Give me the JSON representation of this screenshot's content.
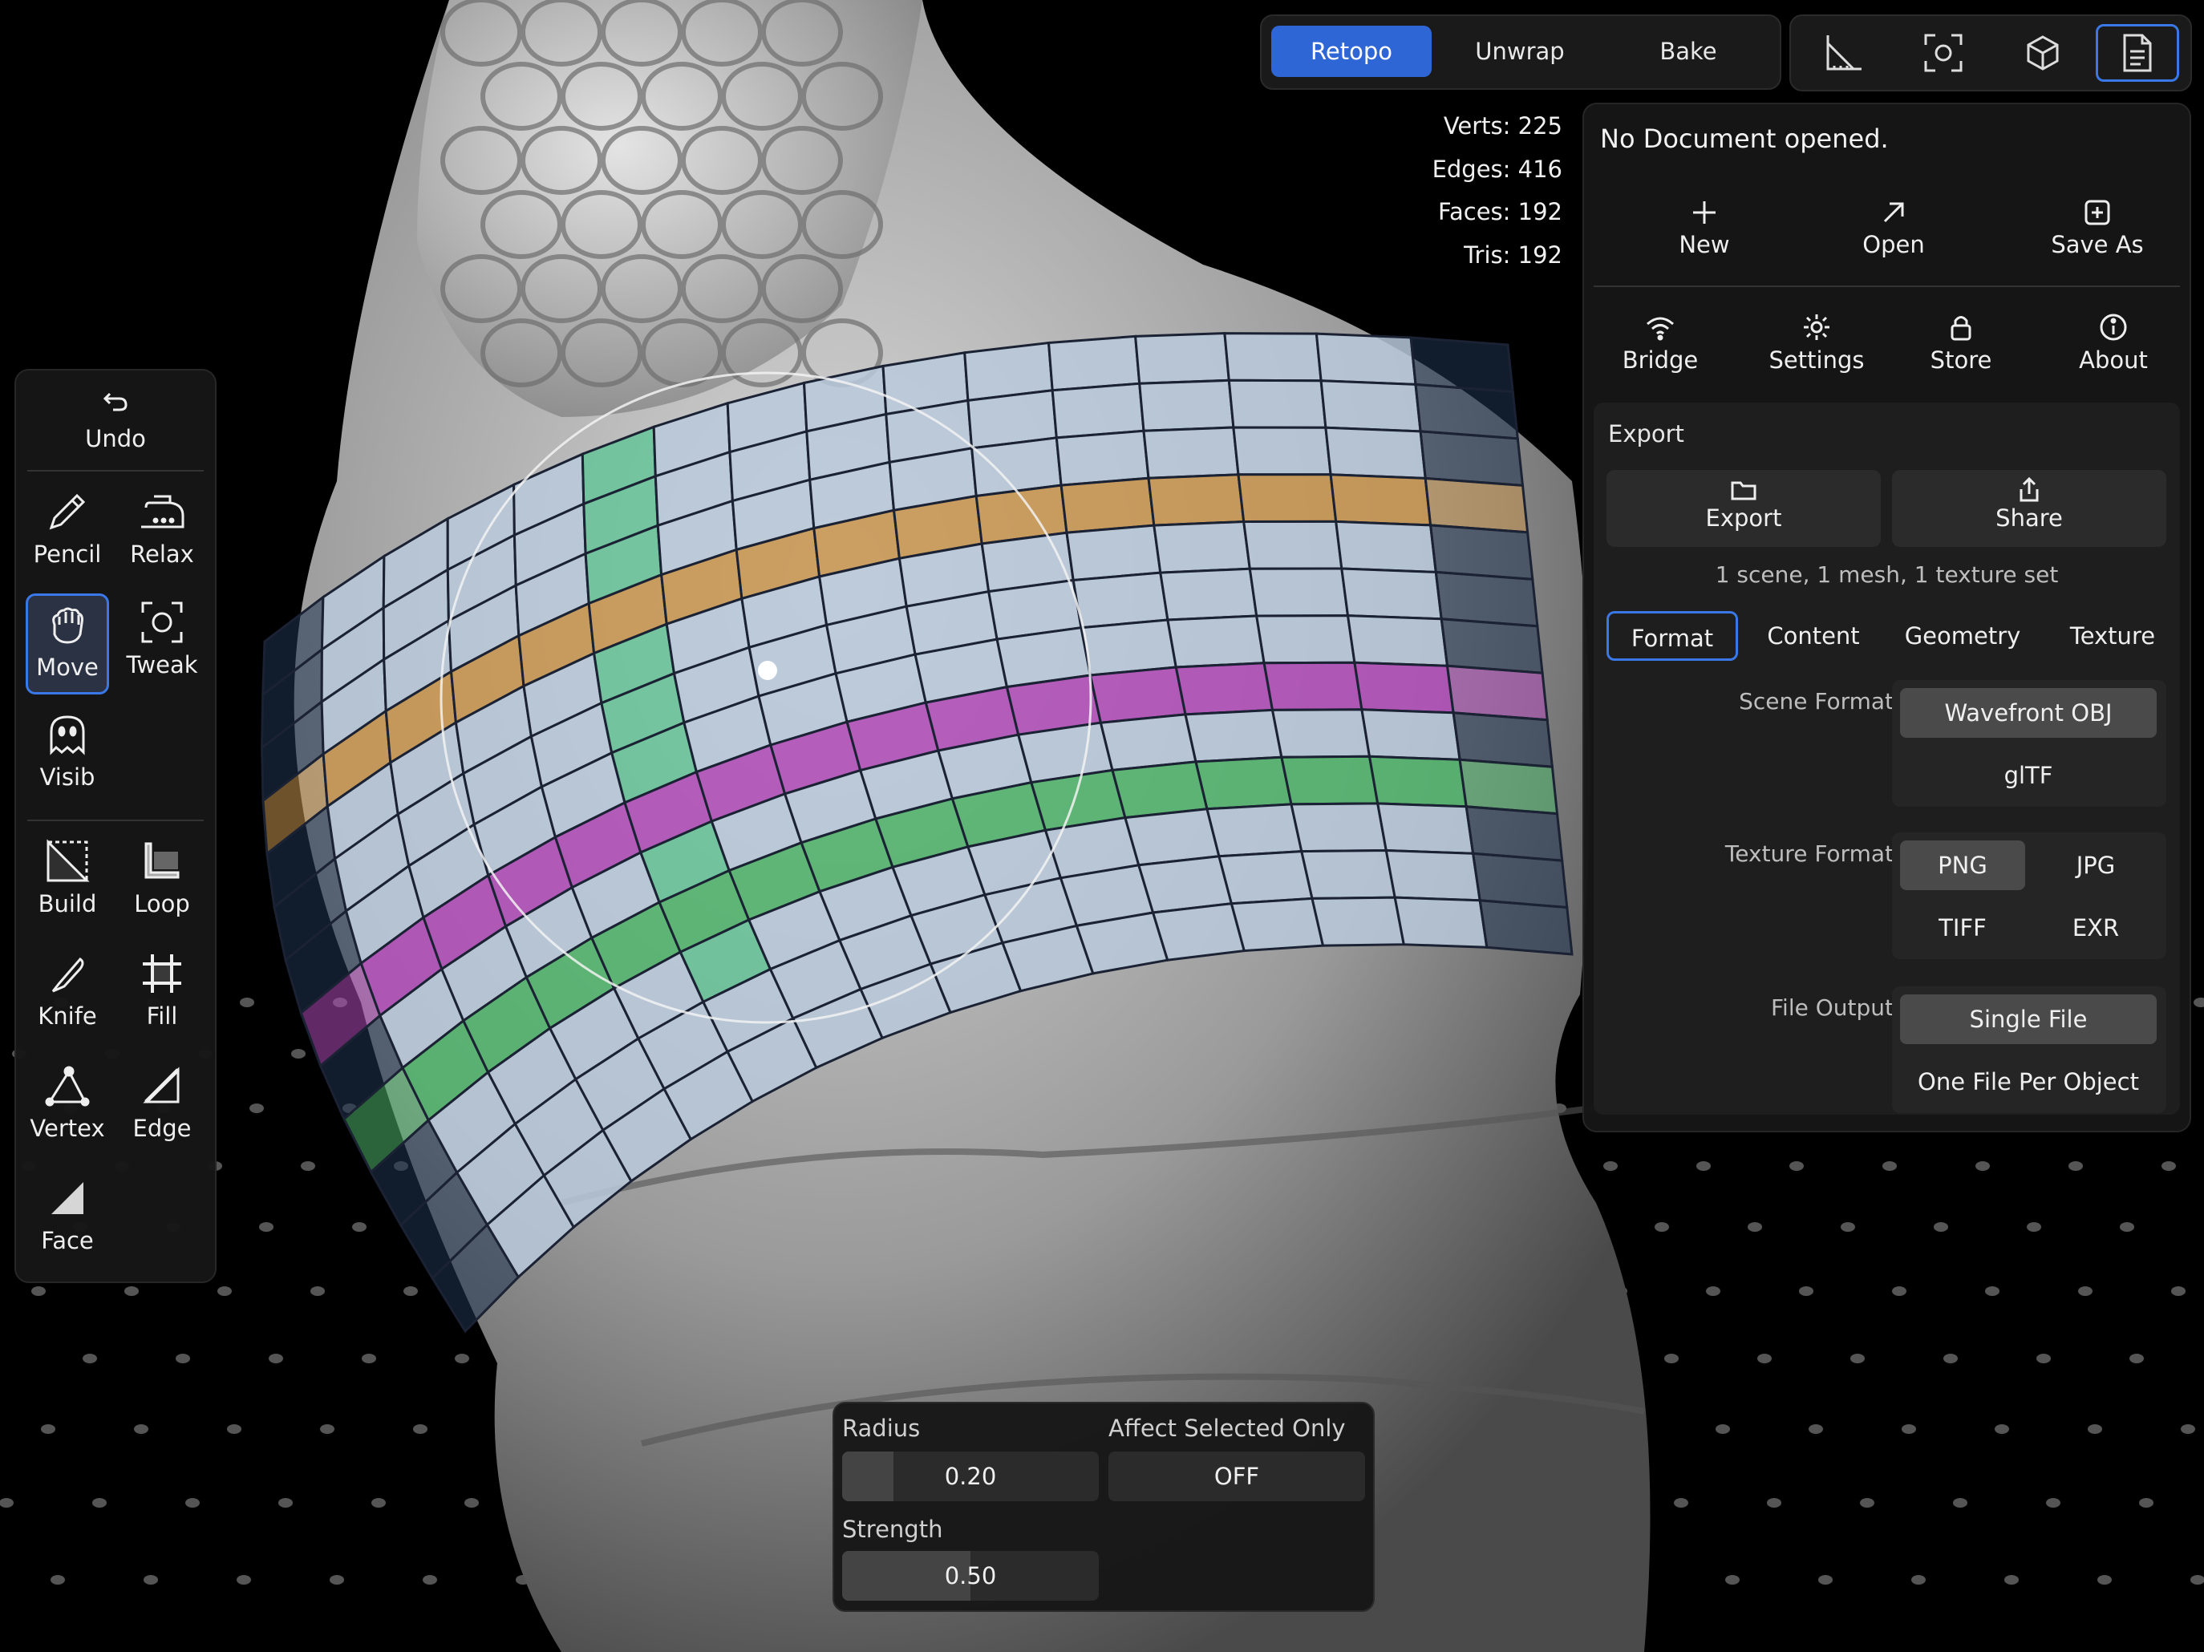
{
  "mode_tabs": {
    "retopo": "Retopo",
    "unwrap": "Unwrap",
    "bake": "Bake",
    "active": "Retopo"
  },
  "view_tools": {
    "icons": [
      "ruler-triangle-icon",
      "focus-frame-icon",
      "cube-icon",
      "document-icon"
    ],
    "active": "document-icon"
  },
  "stats": {
    "verts": "Verts: 225",
    "edges": "Edges: 416",
    "faces": "Faces: 192",
    "tris": "Tris: 192"
  },
  "doc": {
    "title": "No Document opened.",
    "new": "New",
    "open": "Open",
    "save_as": "Save As",
    "bridge": "Bridge",
    "settings": "Settings",
    "store": "Store",
    "about": "About",
    "export_header": "Export",
    "export_btn": "Export",
    "share_btn": "Share",
    "summary": "1 scene, 1 mesh, 1 texture set",
    "tabs": [
      "Format",
      "Content",
      "Geometry",
      "Texture"
    ],
    "active_tab": "Format",
    "scene_format_label": "Scene Format",
    "scene_formats": [
      "Wavefront OBJ",
      "glTF"
    ],
    "scene_format_selected": "Wavefront OBJ",
    "texture_format_label": "Texture Format",
    "texture_formats": [
      "PNG",
      "JPG",
      "TIFF",
      "EXR"
    ],
    "texture_format_selected": "PNG",
    "file_output_label": "File Output",
    "file_outputs": [
      "Single File",
      "One File Per Object"
    ],
    "file_output_selected": "Single File"
  },
  "toolbar": {
    "undo": "Undo",
    "pencil": "Pencil",
    "relax": "Relax",
    "move": "Move",
    "tweak": "Tweak",
    "visib": "Visib",
    "build": "Build",
    "loop": "Loop",
    "knife": "Knife",
    "fill": "Fill",
    "vertex": "Vertex",
    "edge": "Edge",
    "face": "Face",
    "active": "Move"
  },
  "brush": {
    "radius_label": "Radius",
    "radius_value": "0.20",
    "radius_fraction": 0.2,
    "affect_label": "Affect Selected Only",
    "affect_value": "OFF",
    "strength_label": "Strength",
    "strength_value": "0.50",
    "strength_fraction": 0.5
  },
  "colors": {
    "accent": "#2f66d6",
    "mesh_base": "#b9c9dc",
    "loop_orange": "#c9954e",
    "loop_magenta": "#b04ab8",
    "loop_green": "#4fb46a",
    "loop_teal": "#5fc496"
  }
}
